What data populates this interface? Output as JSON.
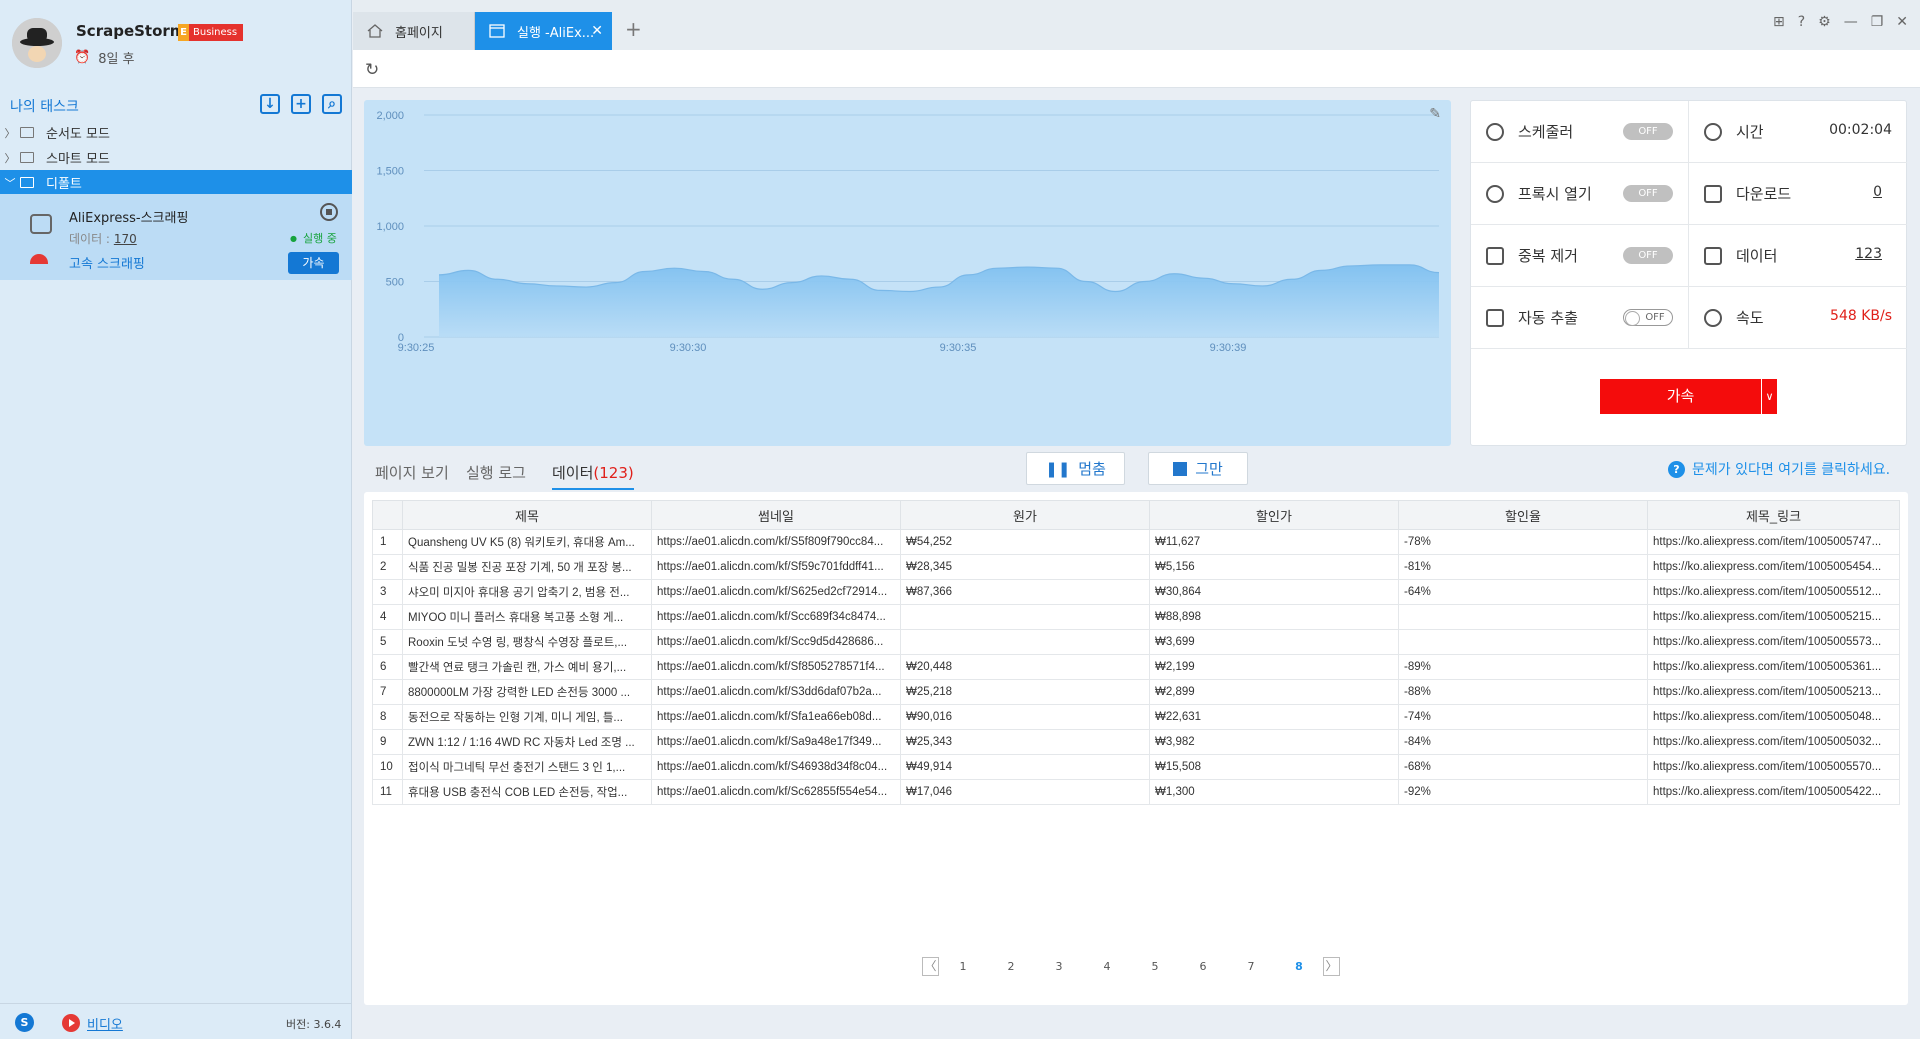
{
  "app": {
    "name": "ScrapeStorm",
    "badge": "Business",
    "badge_letter": "E",
    "expiry": "8일 후"
  },
  "sidebar": {
    "title": "나의 태스크",
    "items": [
      {
        "label": "순서도 모드"
      },
      {
        "label": "스마트 모드"
      },
      {
        "label": "디폴트"
      }
    ],
    "task": {
      "name": "AliExpress-스크래핑",
      "data_label": "데이터 :",
      "data_value": "170",
      "status": "실행 중",
      "speed_label": "고속 스크래핑",
      "accel_label": "가속"
    },
    "footer": {
      "video": "비디오",
      "version": "버전: 3.6.4"
    }
  },
  "tabs": [
    {
      "label": "홈페이지"
    },
    {
      "label": "실행 -AliEx..."
    }
  ],
  "chart_data": {
    "type": "area",
    "x": [
      "9:30:25",
      "9:30:30",
      "9:30:35",
      "9:30:39"
    ],
    "y_ticks": [
      "2,000",
      "1,500",
      "1,000",
      "500",
      "0"
    ],
    "ylim": [
      0,
      2000
    ],
    "series": [
      {
        "values": [
          560,
          600,
          520,
          480,
          460,
          450,
          490,
          590,
          620,
          590,
          520,
          430,
          490,
          550,
          520,
          420,
          410,
          450,
          560,
          620,
          630,
          620,
          500,
          410,
          500,
          570,
          530,
          480,
          460,
          520,
          600,
          640,
          650,
          650,
          580
        ]
      }
    ],
    "color": "#7fc0f0"
  },
  "stats": {
    "scheduler": {
      "label": "스케줄러",
      "value": "OFF"
    },
    "time": {
      "label": "시간",
      "value": "00:02:04"
    },
    "proxy": {
      "label": "프록시 열기",
      "value": "OFF"
    },
    "download": {
      "label": "다운로드",
      "value": "0"
    },
    "dedupe": {
      "label": "중복 제거",
      "value": "OFF"
    },
    "data": {
      "label": "데이터",
      "value": "123"
    },
    "auto": {
      "label": "자동 추출",
      "value": "OFF"
    },
    "speed": {
      "label": "속도",
      "value": "548 KB/s"
    },
    "accel_button": "가속"
  },
  "subtabs": {
    "page_view": "페이지 보기",
    "log": "실행 로그",
    "data": "데이터",
    "data_count": "(123)"
  },
  "controls": {
    "pause": "멈춤",
    "stop": "그만"
  },
  "help": "문제가 있다면 여기를 클릭하세요.",
  "table": {
    "columns": [
      "제목",
      "썸네일",
      "원가",
      "할인가",
      "할인율",
      "제목_링크"
    ],
    "rows": [
      [
        "1",
        "Quansheng UV K5 (8) 워키토키, 휴대용 Am...",
        "https://ae01.alicdn.com/kf/S5f809f790cc84...",
        "₩54,252",
        "₩11,627",
        "-78%",
        "https://ko.aliexpress.com/item/1005005747..."
      ],
      [
        "2",
        "식품 진공 밀봉 진공 포장 기계, 50 개 포장 봉...",
        "https://ae01.alicdn.com/kf/Sf59c701fddff41...",
        "₩28,345",
        "₩5,156",
        "-81%",
        "https://ko.aliexpress.com/item/1005005454..."
      ],
      [
        "3",
        "샤오미 미지아 휴대용 공기 압축기 2, 범용 전...",
        "https://ae01.alicdn.com/kf/S625ed2cf72914...",
        "₩87,366",
        "₩30,864",
        "-64%",
        "https://ko.aliexpress.com/item/1005005512..."
      ],
      [
        "4",
        "MIYOO 미니 플러스 휴대용 복고풍 소형 게...",
        "https://ae01.alicdn.com/kf/Scc689f34c8474...",
        "",
        "₩88,898",
        "",
        "https://ko.aliexpress.com/item/1005005215..."
      ],
      [
        "5",
        "Rooxin 도넛 수영 링, 팽창식 수영장 플로트,...",
        "https://ae01.alicdn.com/kf/Scc9d5d428686...",
        "",
        "₩3,699",
        "",
        "https://ko.aliexpress.com/item/1005005573..."
      ],
      [
        "6",
        "빨간색 연료 탱크 가솔린 캔, 가스 예비 용기,...",
        "https://ae01.alicdn.com/kf/Sf8505278571f4...",
        "₩20,448",
        "₩2,199",
        "-89%",
        "https://ko.aliexpress.com/item/1005005361..."
      ],
      [
        "7",
        "8800000LM 가장 강력한 LED 손전등 3000 ...",
        "https://ae01.alicdn.com/kf/S3dd6daf07b2a...",
        "₩25,218",
        "₩2,899",
        "-88%",
        "https://ko.aliexpress.com/item/1005005213..."
      ],
      [
        "8",
        "동전으로 작동하는 인형 기계, 미니 게임, 틀...",
        "https://ae01.alicdn.com/kf/Sfa1ea66eb08d...",
        "₩90,016",
        "₩22,631",
        "-74%",
        "https://ko.aliexpress.com/item/1005005048..."
      ],
      [
        "9",
        "ZWN 1:12 / 1:16 4WD RC 자동차 Led 조명 ...",
        "https://ae01.alicdn.com/kf/Sa9a48e17f349...",
        "₩25,343",
        "₩3,982",
        "-84%",
        "https://ko.aliexpress.com/item/1005005032..."
      ],
      [
        "10",
        "접이식 마그네틱 무선 충전기 스탠드 3 인 1,...",
        "https://ae01.alicdn.com/kf/S46938d34f8c04...",
        "₩49,914",
        "₩15,508",
        "-68%",
        "https://ko.aliexpress.com/item/1005005570..."
      ],
      [
        "11",
        "휴대용 USB 충전식 COB LED 손전등, 작업...",
        "https://ae01.alicdn.com/kf/Sc62855f554e54...",
        "₩17,046",
        "₩1,300",
        "-92%",
        "https://ko.aliexpress.com/item/1005005422..."
      ]
    ]
  },
  "pagination": {
    "pages": [
      "1",
      "2",
      "3",
      "4",
      "5",
      "6",
      "7",
      "8"
    ],
    "current": "8"
  }
}
